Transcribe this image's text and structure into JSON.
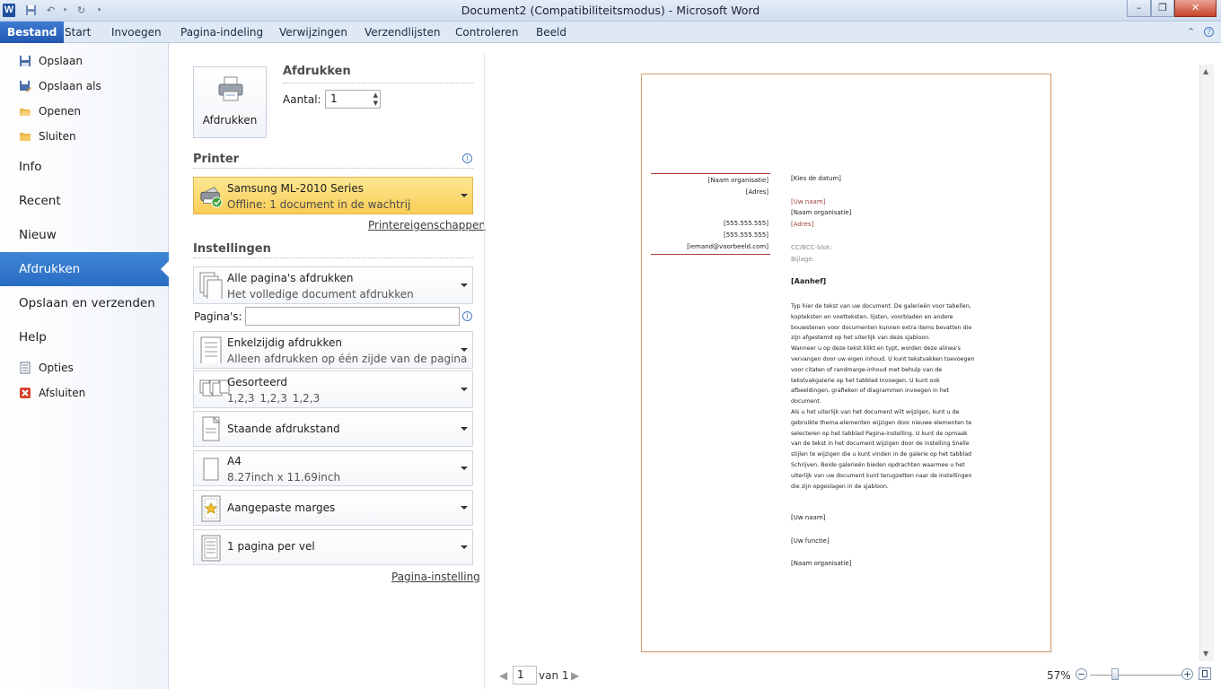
{
  "window": {
    "title": "Document2 (Compatibiliteitsmodus)  -  Microsoft Word",
    "logo": "W",
    "controls": [
      "minimize-icon",
      "restore-icon",
      "close-icon"
    ]
  },
  "ribbon": {
    "tabs": [
      "Bestand",
      "Start",
      "Invoegen",
      "Pagina-indeling",
      "Verwijzingen",
      "Verzendlijsten",
      "Controleren",
      "Beeld"
    ]
  },
  "backstage_nav": {
    "small_top": [
      {
        "label": "Opslaan",
        "icon": "save-icon"
      },
      {
        "label": "Opslaan als",
        "icon": "save-as-icon"
      },
      {
        "label": "Openen",
        "icon": "open-folder-icon"
      },
      {
        "label": "Sluiten",
        "icon": "close-folder-icon"
      }
    ],
    "large": [
      "Info",
      "Recent",
      "Nieuw",
      "Afdrukken",
      "Opslaan en verzenden",
      "Help"
    ],
    "active": "Afdrukken",
    "small_bottom": [
      {
        "label": "Opties",
        "icon": "options-icon"
      },
      {
        "label": "Afsluiten",
        "icon": "exit-icon"
      }
    ]
  },
  "print": {
    "button_label": "Afdrukken",
    "heading": "Afdrukken",
    "copies_label": "Aantal:",
    "copies_value": "1",
    "printer_heading": "Printer",
    "printer_name": "Samsung ML-2010 Series",
    "printer_status": "Offline: 1 document in de wachtrij",
    "printer_props_link": "Printereigenschappen",
    "settings_heading": "Instellingen",
    "pages_label": "Pagina's:",
    "pages_value": "",
    "settings": [
      {
        "line1": "Alle pagina's afdrukken",
        "line2": "Het volledige document afdrukken",
        "icon": "pages-icon"
      },
      {
        "line1": "Enkelzijdig afdrukken",
        "line2": "Alleen afdrukken op één zijde van de pagina",
        "icon": "one-sided-icon"
      },
      {
        "line1": "Gesorteerd",
        "line2": "1,2,3    1,2,3    1,2,3",
        "icon": "collated-icon"
      },
      {
        "line1": "Staande afdrukstand",
        "line2": "",
        "icon": "portrait-icon"
      },
      {
        "line1": "A4",
        "line2": "8.27inch x 11.69inch",
        "icon": "paper-size-icon"
      },
      {
        "line1": "Aangepaste marges",
        "line2": "",
        "icon": "margins-icon"
      },
      {
        "line1": "1 pagina per vel",
        "line2": "",
        "icon": "pages-per-sheet-icon"
      }
    ],
    "page_setup_link": "Pagina-instelling"
  },
  "preview": {
    "left_block": [
      "[Naam organisatie]",
      "[Adres]",
      "[555.555.555]",
      "[555.555.555]",
      "[iemand@voorbeeld.com]"
    ],
    "date": "[Kies de datum]",
    "recipient_name": "[Uw naam]",
    "recipient_org": "[Naam organisatie]",
    "recipient_address": "[Adres]",
    "cc": "CC/BCC-blok:",
    "attachment": "Bijlage:",
    "salutation": "[Aanhef]",
    "body_lines": [
      "Typ hier de tekst van uw document. De galerieën voor tabellen,",
      "kopteksten en voetteksten, lijsten, voorbladen en andere",
      "bouwstenen voor documenten kunnen extra items bevatten die",
      "zijn afgestemd op het uiterlijk van deze sjabloon.",
      "Wanneer u op deze tekst klikt en typt, worden deze alinea's",
      "vervangen door uw eigen inhoud. U kunt tekstvakken toevoegen",
      "voor citaten of randmarge-inhoud met behulp van de",
      "tekstvakgalerie op het tabblad Invoegen. U kunt ook",
      "afbeeldingen, grafieken of diagrammen invoegen in het",
      "document.",
      "Als u het uiterlijk van het document wilt wijzigen, kunt u de",
      "gebruikte thema-elementen wijzigen door nieuwe elementen te",
      "selecteren op het tabblad Pagina-instelling. U kunt de opmaak",
      "van de tekst in het document wijzigen door de instelling Snelle",
      "stijlen te wijzigen die u kunt vinden in de galerie op het tabblad",
      "Schrijven. Beide galerieën bieden opdrachten waarmee u het",
      "uiterlijk van uw document kunt terugzetten naar de instellingen",
      "die zijn opgeslagen in de sjabloon."
    ],
    "sign_name": "[Uw naam]",
    "sign_function": "[Uw functie]",
    "sign_org": "[Naam organisatie]"
  },
  "statusbar": {
    "current_page": "1",
    "page_of": "van 1",
    "zoom": "57%"
  }
}
